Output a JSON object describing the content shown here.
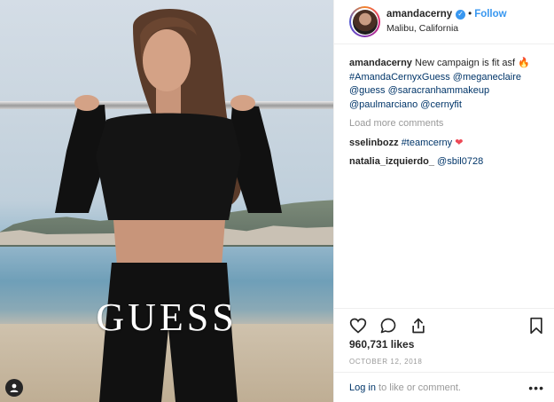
{
  "post": {
    "brand_overlay": "GUESS"
  },
  "header": {
    "username": "amandacerny",
    "dot": "•",
    "follow_label": "Follow",
    "location": "Malibu, California"
  },
  "caption": {
    "username": "amandacerny",
    "text": "New campaign is fit asf 🔥",
    "tags": [
      "#AmandaCernyxGuess",
      "@meganeclaire",
      "@guess",
      "@saracranhammakeup",
      "@paulmarciano",
      "@cernyfit"
    ]
  },
  "load_more": "Load more comments",
  "comments": [
    {
      "username": "sselinbozz",
      "text": "#teamcerny",
      "emoji": "❤"
    },
    {
      "username": "natalia_izquierdo_",
      "text": "@sbil0728"
    }
  ],
  "actions": {
    "icons": [
      "heart-icon",
      "comment-icon",
      "share-icon",
      "bookmark-icon"
    ],
    "likes": "960,731 likes",
    "date": "OCTOBER 12, 2018"
  },
  "login": {
    "link": "Log in",
    "rest": " to like or comment.",
    "more": "•••"
  },
  "colors": {
    "link": "#003569",
    "follow": "#3897f0",
    "muted": "#999999",
    "heart": "#ed4956"
  }
}
